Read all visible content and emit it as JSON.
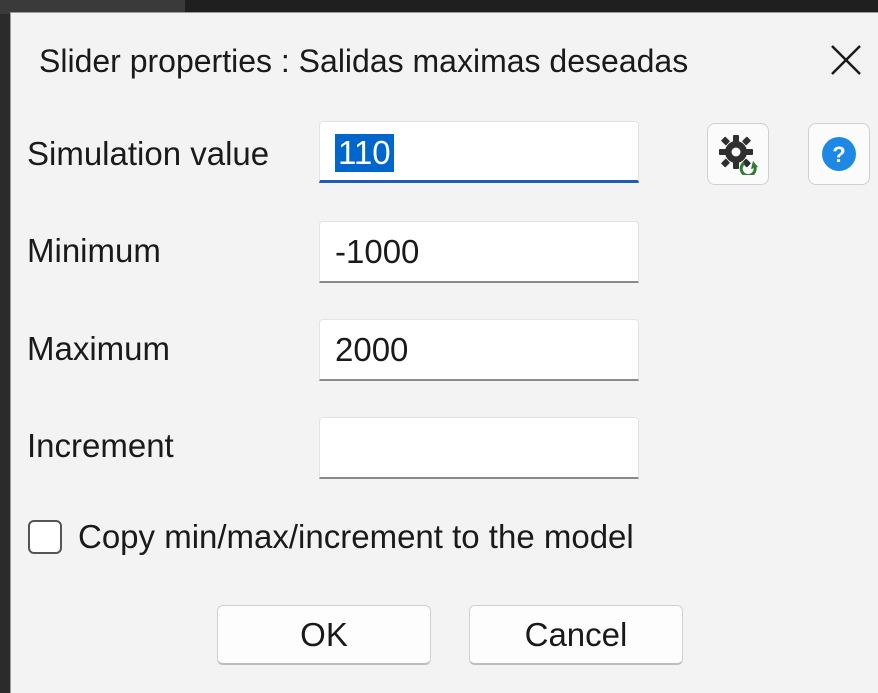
{
  "dialog": {
    "title": "Slider properties : Salidas maximas deseadas",
    "close_icon": "close-icon"
  },
  "fields": {
    "simulation_value": {
      "label": "Simulation value",
      "value": "110",
      "selected": true
    },
    "minimum": {
      "label": "Minimum",
      "value": "-1000"
    },
    "maximum": {
      "label": "Maximum",
      "value": "2000"
    },
    "increment": {
      "label": "Increment",
      "value": ""
    }
  },
  "icons": {
    "settings": "gear-refresh-icon",
    "help": "help-icon",
    "help_glyph": "?"
  },
  "checkbox": {
    "label": "Copy min/max/increment to the model",
    "checked": false
  },
  "buttons": {
    "ok": "OK",
    "cancel": "Cancel"
  },
  "colors": {
    "accent": "#1a5fb4",
    "selection": "#0066cc",
    "help_blue": "#1e88e5",
    "gear_dark": "#2f2f2f",
    "gear_green": "#2e7d32"
  }
}
